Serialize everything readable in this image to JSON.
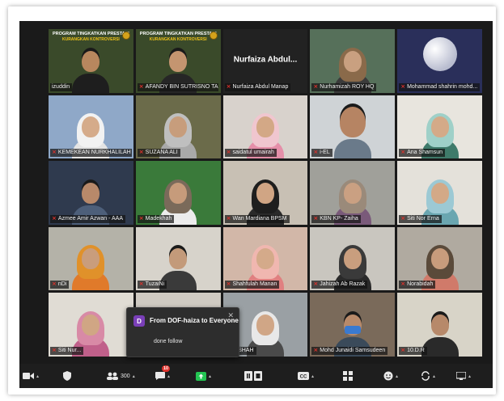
{
  "chat_popup": {
    "sender_initial": "D",
    "from_line": "From DOF-haiza to Everyone",
    "message": "done follow"
  },
  "toolbar": {
    "participants_count": "300",
    "chat_badge": "10"
  },
  "banner": {
    "line1": "PROGRAM TINGKATKAN PRESTASI",
    "line2": "KURANGKAN KONTROVERSI"
  },
  "tiles": [
    {
      "name": "izuddin",
      "mic_off": false,
      "banner": true,
      "active": true,
      "bg": "#3a4a2a",
      "skin": "#b8875e",
      "clothes": "#1e1e1e",
      "hijab": ""
    },
    {
      "name": "AFANDY BIN SUTRISNO TANJUNG",
      "mic_off": true,
      "banner": true,
      "active": false,
      "bg": "#3a4a2a",
      "skin": "#c49570",
      "clothes": "#262626",
      "hijab": ""
    },
    {
      "name": "Nurfaiza Abdul Manap",
      "mic_off": true,
      "banner": false,
      "active": false,
      "bg": "#222222",
      "big": "Nurfaiza  Abdul...",
      "hidden_video": true
    },
    {
      "name": "Nurhamizah ROY HQ",
      "mic_off": true,
      "banner": false,
      "active": false,
      "bg": "#56705a",
      "skin": "#c9a080",
      "clothes": "#3b3b3b",
      "hijab": "#8a6a4a"
    },
    {
      "name": "Mohammad shahrin mohd...",
      "mic_off": true,
      "banner": false,
      "active": false,
      "bg": "#2a2f5a",
      "skin": "#e6e6ea",
      "clothes": "#3a3a80",
      "hijab": "",
      "globe": true
    },
    {
      "name": "KEMEKEAN NURKHALILAH",
      "mic_off": true,
      "banner": false,
      "active": false,
      "bg": "#8fa8c8",
      "skin": "#d5ab8a",
      "clothes": "#e4e4e4",
      "hijab": "#f2f2f2"
    },
    {
      "name": "SUZANA ALI",
      "mic_off": true,
      "banner": false,
      "active": false,
      "bg": "#6b6b4a",
      "skin": "#c79d7c",
      "clothes": "#a9a9a9",
      "hijab": "#bfbfbf"
    },
    {
      "name": "saidatul umairah",
      "mic_off": true,
      "banner": false,
      "active": false,
      "bg": "#d8d2cc",
      "skin": "#d3a886",
      "clothes": "#e58fa9",
      "hijab": "#f0c6cf"
    },
    {
      "name": "i-EL",
      "mic_off": true,
      "banner": false,
      "active": false,
      "bg": "#cfd3d6",
      "skin": "#b68463",
      "clothes": "#6a7a8a",
      "hijab": "",
      "big_face": true
    },
    {
      "name": "Ana Shamsun",
      "mic_off": true,
      "banner": false,
      "active": false,
      "bg": "#e8e5de",
      "skin": "#d4aa88",
      "clothes": "#3f7a6a",
      "hijab": "#9fd0c8"
    },
    {
      "name": "Azmee Amir Azwan - AAA",
      "mic_off": true,
      "banner": false,
      "active": false,
      "bg": "#2f3a4e",
      "skin": "#b8896a",
      "clothes": "#4d5f7a",
      "hijab": ""
    },
    {
      "name": "Madekhah",
      "mic_off": true,
      "banner": false,
      "active": false,
      "bg": "#3a7a3a",
      "skin": "#c69b7b",
      "clothes": "#ececec",
      "hijab": "#7a6a5a"
    },
    {
      "name": "Wan Mardiana BPSM",
      "mic_off": true,
      "banner": false,
      "active": false,
      "bg": "#c8c0b4",
      "skin": "#d0a584",
      "clothes": "#2a2a2a",
      "hijab": "#1e1e1e"
    },
    {
      "name": "KBN KP- Zaiha",
      "mic_off": true,
      "banner": false,
      "active": false,
      "bg": "#a0a09a",
      "skin": "#caa082",
      "clothes": "#7a5a7a",
      "hijab": "#9a8a7a"
    },
    {
      "name": "Siti Nor Erna",
      "mic_off": true,
      "banner": false,
      "active": false,
      "bg": "#e4e1da",
      "skin": "#d3a987",
      "clothes": "#6aa6b0",
      "hijab": "#9cc9d4"
    },
    {
      "name": "nDi",
      "mic_off": true,
      "banner": false,
      "active": false,
      "bg": "#b4b2a8",
      "skin": "#c99d7c",
      "clothes": "#e07a2a",
      "hijab": "#e0912a"
    },
    {
      "name": "TuzaiNi",
      "mic_off": true,
      "banner": false,
      "active": false,
      "bg": "#d7d3cb",
      "skin": "#c39a7a",
      "clothes": "#3a3a3a",
      "hijab": ""
    },
    {
      "name": "Shahfulah Manan",
      "mic_off": true,
      "banner": false,
      "active": false,
      "bg": "#d2b7a8",
      "skin": "#d4aa8a",
      "clothes": "#e08080",
      "hijab": "#f0b7b0"
    },
    {
      "name": "Jahizah Ab Razak",
      "mic_off": true,
      "banner": false,
      "active": false,
      "bg": "#c9c6bf",
      "skin": "#c99e7e",
      "clothes": "#2a2a2a",
      "hijab": "#3a3a3a"
    },
    {
      "name": "Norabidah",
      "mic_off": true,
      "banner": false,
      "active": false,
      "bg": "#b0aaa0",
      "skin": "#c89c7c",
      "clothes": "#d07a6a",
      "hijab": "#5a4a3a"
    },
    {
      "name": "Siti Nur...",
      "mic_off": true,
      "banner": false,
      "active": false,
      "bg": "#e0dcd4",
      "skin": "#d0a684",
      "clothes": "#c0608a",
      "hijab": "#d88aa6"
    },
    {
      "name": "",
      "mic_off": false,
      "banner": false,
      "active": false,
      "bg": "#cfcac2",
      "skin": "#c79c7c",
      "clothes": "#3a3a3a",
      "hijab": "",
      "covered": true
    },
    {
      "name": "A.SHAH",
      "mic_off": true,
      "banner": false,
      "active": false,
      "bg": "#9aa0a4",
      "skin": "#d0a686",
      "clothes": "#4a4a4a",
      "hijab": "#e8e8e8"
    },
    {
      "name": "Mohd Junaidi Samsudeen",
      "mic_off": true,
      "banner": false,
      "active": false,
      "bg": "#7a6a5a",
      "skin": "#b88a6a",
      "clothes": "#3a4a5a",
      "hijab": "",
      "mask": true
    },
    {
      "name": "10.D.R",
      "mic_off": true,
      "banner": false,
      "active": false,
      "bg": "#d8d4c8",
      "skin": "#b7896a",
      "clothes": "#2a2a2a",
      "hijab": ""
    }
  ]
}
